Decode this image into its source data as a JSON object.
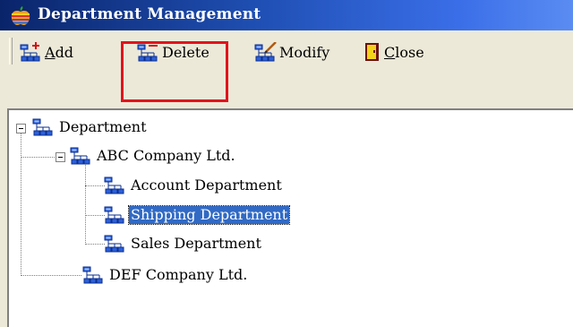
{
  "window": {
    "title": "Department Management",
    "colors": {
      "title_gradient_start": "#0a246a",
      "title_gradient_end": "#5a8cf2",
      "selection": "#316ac5",
      "highlight_box": "#e0141c"
    }
  },
  "toolbar": {
    "add_label": "Add",
    "add_underline": "A",
    "add_rest": "dd",
    "delete_label": "Delete",
    "modify_label": "Modify",
    "close_label": "Close",
    "close_underline": "C",
    "close_rest": "lose"
  },
  "tree": {
    "root": {
      "label": "Department",
      "expanded": true,
      "icon": "org-chart-icon"
    },
    "companies": [
      {
        "label": "ABC Company Ltd.",
        "expanded": true,
        "icon": "org-chart-icon",
        "departments": [
          {
            "label": "Account Department",
            "selected": false,
            "icon": "org-chart-icon"
          },
          {
            "label": "Shipping Department",
            "selected": true,
            "icon": "org-chart-icon"
          },
          {
            "label": "Sales Department",
            "selected": false,
            "icon": "org-chart-icon"
          }
        ]
      },
      {
        "label": "DEF Company Ltd.",
        "expanded": false,
        "icon": "org-chart-icon"
      }
    ]
  }
}
